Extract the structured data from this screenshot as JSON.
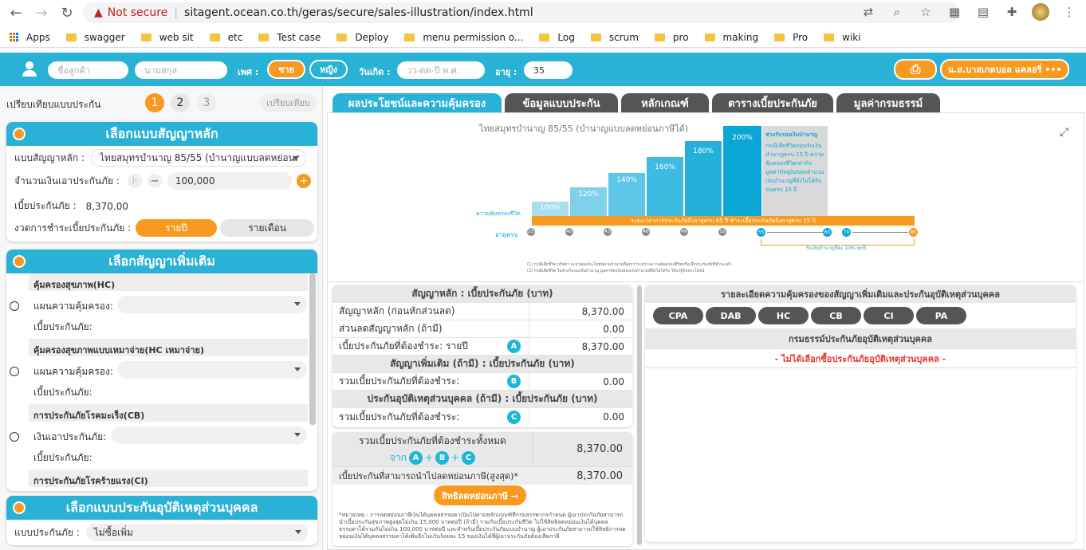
{
  "browser": {
    "not_secure": "Not secure",
    "url": "sitagent.ocean.co.th/geras/secure/sales-illustration/index.html"
  },
  "bookmarks": [
    "Apps",
    "swagger",
    "web sit",
    "etc",
    "Test case",
    "Deploy",
    "menu permission o...",
    "Log",
    "scrum",
    "pro",
    "making",
    "Pro",
    "wiki"
  ],
  "topbar": {
    "name_ph": "ชื่อลูกค้า",
    "surname_ph": "นามสกุล",
    "sex_label": "เพศ :",
    "male": "ชาย",
    "female": "หญิง",
    "dob_label": "วันเกิด :",
    "dob_ph": "วว-ดด-ปี พ.ศ.",
    "age_label": "อายุ :",
    "age": "35",
    "agent": "น.ส.บาสเกตบอล แคลอรี่ •••"
  },
  "compare": {
    "label": "เปรียบเทียบแบบประกัน",
    "steps": [
      "1",
      "2",
      "3"
    ],
    "btn": "เปรียบเทียบ"
  },
  "main_plan": {
    "title": "เลือกแบบสัญญาหลัก",
    "plan_label": "แบบสัญญาหลัก :",
    "plan_value": "ไทยสมุทรบำนาญ 85/55 (บำนาญแบบลดหย่อนภาษีได้)",
    "sum_label": "จำนวนเงินเอาประกันภัย :",
    "sum_value": "100,000",
    "premium_label": "เบี้ยประกันภัย :",
    "premium_value": "8,370.00",
    "period_label": "งวดการชำระเบี้ยประกันภัย :",
    "yearly": "รายปี",
    "monthly": "รายเดือน"
  },
  "riders": {
    "title": "เลือกสัญญาเพิ่มเติม",
    "items": [
      {
        "name": "คุ้มครองสุขภาพ(HC)",
        "f1": "แผนความคุ้มครอง:",
        "f2": "เบี้ยประกันภัย:"
      },
      {
        "name": "คุ้มครองสุขภาพแบบเหมาจ่าย(HC เหมาจ่าย)",
        "f1": "แผนความคุ้มครอง:",
        "f2": "เบี้ยประกันภัย:"
      },
      {
        "name": "การประกันภัยโรคมะเร็ง(CB)",
        "f1": "เงินเอาประกันภัย:",
        "f2": "เบี้ยประกันภัย:"
      },
      {
        "name": "การประกันภัยโรคร้ายแรง(CI)"
      }
    ]
  },
  "pa": {
    "title": "เลือกแบบประกันอุบัติเหตุส่วนบุคคล",
    "label": "แบบประกันภัย :",
    "value": "ไม่ซื้อเพิ่ม"
  },
  "tabs": [
    "ผลประโยชน์และความคุ้มครอง",
    "ข้อมูลแบบประกัน",
    "หลักเกณฑ์",
    "ตารางเบี้ยประกันภัย",
    "มูลค่ากรมธรรม์"
  ],
  "chart": {
    "title": "ไทยสมุทรบำนาญ 85/55 (บำนาญแบบลดหย่อนภาษีได้)",
    "bars": [
      "100%",
      "120%",
      "140%",
      "160%",
      "180%",
      "200%"
    ],
    "cover_label": "ความคุ้มครองชีวิต",
    "age_label": "อายุครบ",
    "ages": [
      "25",
      "40",
      "43",
      "46",
      "49",
      "52",
      "55",
      "60",
      "70",
      "85"
    ],
    "orange_text": "ระยะเวลาการประกันภัยถึงอายุครบ 85 ปี ชำระเบี้ยประกันภัยถึงอายุครบ 55 ปี",
    "annuity_text": "รับเงินบำนาญปีละ 10% ทุกปี",
    "box_title": "ช่วงรับรองเงินบำนาญ",
    "box_text": "กรณีเสียชีวิตก่อนรับเงินบำนาญครบ 15 ปี ความคุ้มครองชีวิตเท่ากับมูลค่าปัจจุบันของจำนวนเงินบำนาญที่ยังไม่ได้รับจนครบ 15 ปี",
    "foot1": "(1) กรณีเสียชีวิต บริษัทฯ จะจ่ายผลประโยชน์ตามจำนวนที่สูงกว่าระหว่างความคุ้มครองชีวิตหรือเบี้ยประกันภัยที่ชำระแล้ว",
    "foot2": "(2) กรณีเสียชีวิต ในช่วงรับรองเงินบำนาญ มูลค่าปัจจุบันของเงินบำนาญที่ยังไม่ได้รับ ให้แก่ผู้รับประโยชน์"
  },
  "summary": {
    "h1": "สัญญาหลัก : เบี้ยประกันภัย (บาท)",
    "r1": "สัญญาหลัก (ก่อนหักส่วนลด)",
    "v1": "8,370.00",
    "r2": "ส่วนลดสัญญาหลัก (ถ้ามี)",
    "v2": "0.00",
    "r3": "เบี้ยประกันภัยที่ต้องชำระ: รายปี",
    "v3": "8,370.00",
    "h2": "สัญญาเพิ่มเติม (ถ้ามี) : เบี้ยประกันภัย (บาท)",
    "r4": "รวมเบี้ยประกันภัยที่ต้องชำระ:",
    "v4": "0.00",
    "h3": "ประกันอุบัติเหตุส่วนบุคคล (ถ้ามี) : เบี้ยประกันภัย (บาท)",
    "r5": "รวมเบี้ยประกันภัยที่ต้องชำระ:",
    "v5": "0.00",
    "a": "A",
    "b": "B",
    "c": "C"
  },
  "total": {
    "label": "รวมเบี้ยประกันภัยที่ต้องชำระทั้งหมด",
    "from": "จาก",
    "plus": "+",
    "value": "8,370.00",
    "tax_label": "เบี้ยประกันที่สามารถนำไปลดหย่อนภาษี(สูงสุด)*",
    "tax_value": "8,370.00",
    "btn": "สิทธิลดหย่อนภาษี →",
    "note": "*หมายเหตุ : การลดหย่อนภาษีเงินได้บุคคลธรรมดาเป็นไปตามหลักเกณฑ์ที่กรมสรรพากรกำหนด ผู้เอาประกันภัยสามารถนำเบี้ยประกันสุขภาพสูงสุดไม่เกิน 15,000 บาทต่อปี (ถ้ามี) รวมกับเบี้ยประกันชีวิต ไปใช้สิทธิลดหย่อนเงินได้บุคคลธรรมดาได้รวมกันไม่เกิน 100,000 บาทต่อปี และสำหรับเบี้ยประกันภัยแบบบำนาญ ผู้เอาประกันภัยสามารถใช้สิทธิการลดหย่อนเงินได้บุคคลธรรมดาได้เพิ่มอีกไม่เกินร้อยละ 15 ของเงินได้ที่ผู้เอาประกันภัยต้องเสียภาษี"
  },
  "rider_detail": {
    "title": "รายละเอียดความคุ้มครองของสัญญาเพิ่มเติมและประกันอุบัติเหตุส่วนบุคคล",
    "tabs": [
      "CPA",
      "DAB",
      "HC",
      "CB",
      "CI",
      "PA"
    ],
    "sub": "กรมธรรม์ประกันภัยอุบัติเหตุส่วนบุคคล",
    "empty": "- ไม่ได้เลือกซื้อประกันภัยอุบัติเหตุส่วนบุคคล -"
  },
  "colors": {
    "teal": "#29b2d6",
    "orange": "#f79a1f",
    "red": "#e53935"
  }
}
